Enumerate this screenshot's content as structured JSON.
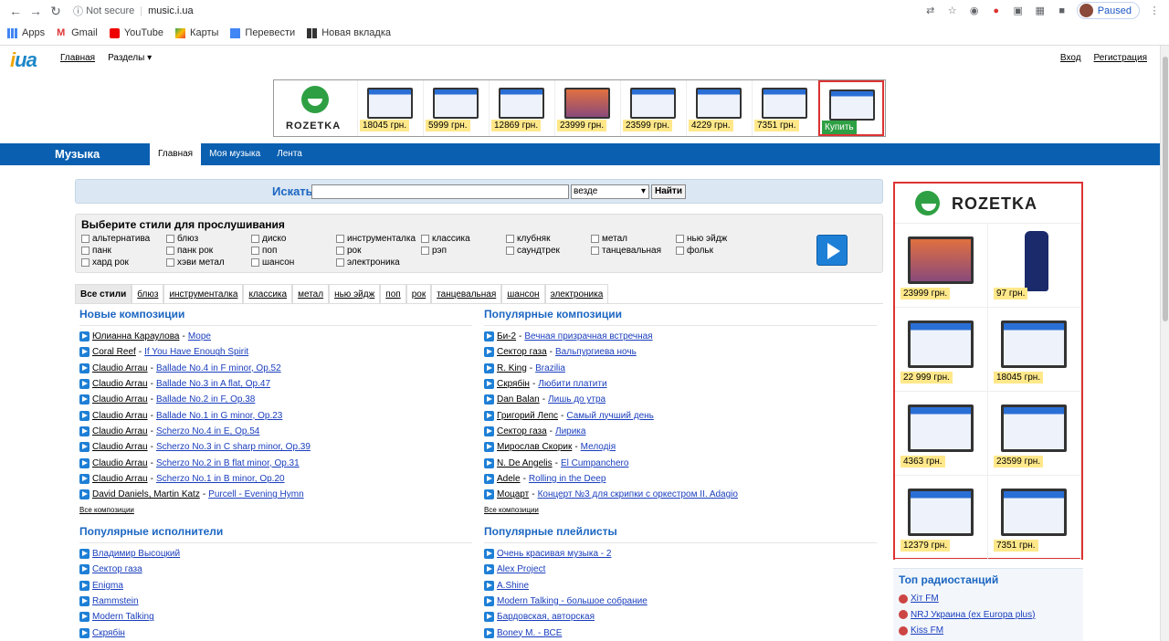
{
  "browser": {
    "not_secure": "Not secure",
    "url": "music.i.ua",
    "paused": "Paused",
    "bookmarks": [
      "Apps",
      "Gmail",
      "YouTube",
      "Карты",
      "Перевести",
      "Новая вкладка"
    ]
  },
  "site": {
    "logo": "ua",
    "nav": [
      "Главная",
      "Разделы ▾"
    ],
    "login": "Вход",
    "register": "Регистрация"
  },
  "banner": {
    "brand": "ROZETKA",
    "prices": [
      "18045 грн.",
      "5999 грн.",
      "12869 грн.",
      "23999 грн.",
      "23599 грн.",
      "4229 грн.",
      "7351 грн."
    ],
    "buy": "Купить"
  },
  "bar": {
    "title": "Музыка",
    "tabs": [
      "Главная",
      "Моя музыка",
      "Лента"
    ]
  },
  "search": {
    "label": "Искать",
    "value": "",
    "scope": "везде",
    "button": "Найти"
  },
  "styles": {
    "heading": "Выберите стили для прослушивания",
    "options": [
      "альтернатива",
      "блюз",
      "диско",
      "инструменталка",
      "классика",
      "клубняк",
      "метал",
      "нью эйдж",
      "панк",
      "панк рок",
      "поп",
      "рок",
      "рэп",
      "саундтрек",
      "танцевальная",
      "фольк",
      "хард рок",
      "хэви метал",
      "шансон",
      "электроника"
    ]
  },
  "genre_tabs": [
    "Все стили",
    "блюз",
    "инструменталка",
    "классика",
    "метал",
    "нью эйдж",
    "поп",
    "рок",
    "танцевальная",
    "шансон",
    "электроника"
  ],
  "new_tracks": {
    "heading": "Новые композиции",
    "rows": [
      [
        "Юлианна Караулова",
        "Море"
      ],
      [
        "Coral Reef",
        "If You Have Enough Spirit"
      ],
      [
        "Claudio Arrau",
        "Ballade No.4 in F minor, Op.52"
      ],
      [
        "Claudio Arrau",
        "Ballade No.3 in A flat, Op.47"
      ],
      [
        "Claudio Arrau",
        "Ballade No.2 in F, Op.38"
      ],
      [
        "Claudio Arrau",
        "Ballade No.1 in G minor, Op.23"
      ],
      [
        "Claudio Arrau",
        "Scherzo No.4 in E, Op.54"
      ],
      [
        "Claudio Arrau",
        "Scherzo No.3 in C sharp minor, Op.39"
      ],
      [
        "Claudio Arrau",
        "Scherzo No.2 in B flat minor, Op.31"
      ],
      [
        "Claudio Arrau",
        "Scherzo No.1 in B minor, Op.20"
      ],
      [
        "David Daniels, Martin Katz",
        "Purcell - Evening Hymn"
      ]
    ],
    "more": "Все композиции"
  },
  "popular_tracks": {
    "heading": "Популярные композиции",
    "rows": [
      [
        "Би-2",
        "Вечная призрачная встречная"
      ],
      [
        "Сектор газа",
        "Вальпургиева ночь"
      ],
      [
        "R. King",
        "Brazilia"
      ],
      [
        "Скрябін",
        "Любити платити"
      ],
      [
        "Dan Balan",
        "Лишь до утра"
      ],
      [
        "Григорий Лепс",
        "Самый лучший день"
      ],
      [
        "Сектор газа",
        "Лирика"
      ],
      [
        "Мирослав Скорик",
        "Мелодія"
      ],
      [
        "N. De Angelis",
        "El Cumpanchero"
      ],
      [
        "Adele",
        "Rolling in the Deep"
      ],
      [
        "Моцарт",
        "Концерт №3 для скрипки с оркестром II. Adagio"
      ]
    ],
    "more": "Все композиции"
  },
  "popular_artists": {
    "heading": "Популярные исполнители",
    "rows": [
      "Владимир Высоцкий",
      "Сектор газа",
      "Enigma",
      "Rammstein",
      "Modern Talking",
      "Скрябін"
    ]
  },
  "popular_playlists": {
    "heading": "Популярные плейлисты",
    "rows": [
      "Очень красивая музыка - 2",
      "Alex Project",
      "A.Shine",
      "Modern Talking - большое собрание",
      "Бардовская, авторская",
      "Boney M. - ВСЕ"
    ]
  },
  "right_ad": {
    "brand": "ROZETKA",
    "prices": [
      "23999 грн.",
      "97 грн.",
      "22 999 грн.",
      "18045 грн.",
      "4363 грн.",
      "23599 грн.",
      "12379 грн.",
      "7351 грн."
    ]
  },
  "radio": {
    "heading": "Топ радиостанций",
    "rows": [
      "Хіт FM",
      "NRJ Украина (ex Europa plus)",
      "Kiss FM"
    ]
  }
}
